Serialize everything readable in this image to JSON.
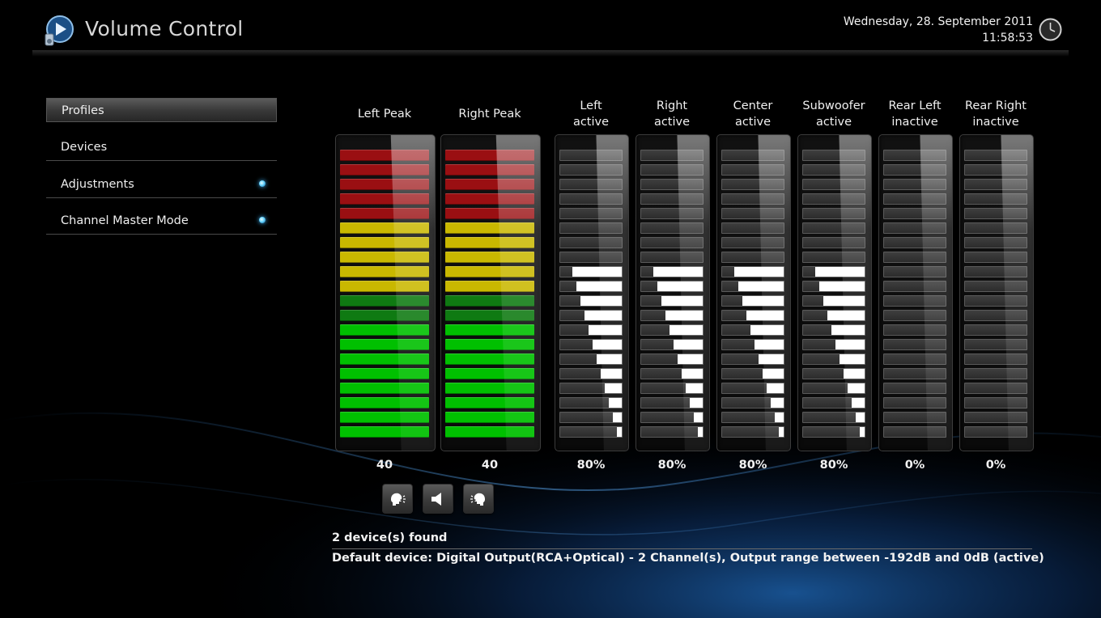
{
  "header": {
    "title": "Volume Control",
    "date": "Wednesday, 28. September 2011",
    "time": "11:58:53"
  },
  "menu": {
    "items": [
      {
        "label": "Profiles",
        "selected": true,
        "indicator": false
      },
      {
        "label": "Devices",
        "selected": false,
        "indicator": false
      },
      {
        "label": "Adjustments",
        "selected": false,
        "indicator": true
      },
      {
        "label": "Channel Master Mode",
        "selected": false,
        "indicator": true
      }
    ]
  },
  "peak_meters": [
    {
      "label": "Left Peak",
      "value": "40"
    },
    {
      "label": "Right Peak",
      "value": "40"
    }
  ],
  "channels": [
    {
      "name": "Left",
      "state": "active",
      "value": "80%",
      "level": 0.8
    },
    {
      "name": "Right",
      "state": "active",
      "value": "80%",
      "level": 0.8
    },
    {
      "name": "Center",
      "state": "active",
      "value": "80%",
      "level": 0.8
    },
    {
      "name": "Subwoofer",
      "state": "active",
      "value": "80%",
      "level": 0.8
    },
    {
      "name": "Rear Left",
      "state": "inactive",
      "value": "0%",
      "level": 0
    },
    {
      "name": "Rear Right",
      "state": "inactive",
      "value": "0%",
      "level": 0
    }
  ],
  "controls": {
    "buttons": [
      {
        "icon": "speaker-left-icon"
      },
      {
        "icon": "speaker-icon"
      },
      {
        "icon": "speaker-right-icon"
      }
    ]
  },
  "status": {
    "device_count": "2 device(s) found",
    "default_device": "Default device: Digital Output(RCA+Optical) - 2 Channel(s), Output range between -192dB and 0dB (active)"
  },
  "colors": {
    "peak_red": "#9a0f12",
    "peak_yellow": "#c9b800",
    "peak_dark_green": "#0f7a12",
    "peak_green": "#00c000",
    "accent_blue": "#3fb8ff"
  }
}
